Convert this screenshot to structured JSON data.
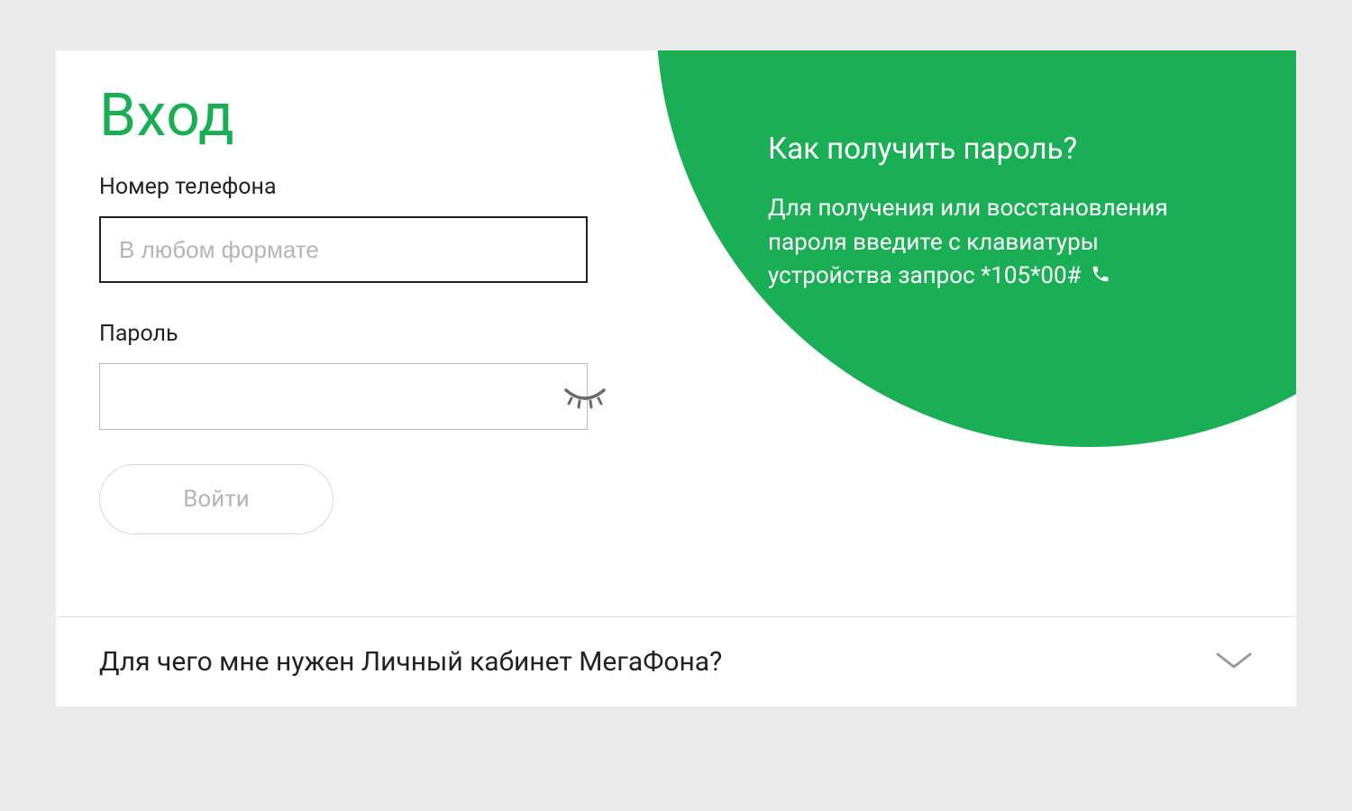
{
  "colors": {
    "accent": "#1aaf54",
    "mutedText": "#b5b5b5",
    "border": "#bdbdbd"
  },
  "login": {
    "title": "Вход",
    "phoneLabel": "Номер телефона",
    "phonePlaceholder": "В любом формате",
    "phoneValue": "",
    "passwordLabel": "Пароль",
    "passwordValue": "",
    "submitLabel": "Войти"
  },
  "help": {
    "title": "Как получить пароль?",
    "text": "Для получения или восстановления пароля введите с клавиатуры устройства запрос *105*00#"
  },
  "accordion": {
    "title": "Для чего мне нужен Личный кабинет МегаФона?"
  }
}
